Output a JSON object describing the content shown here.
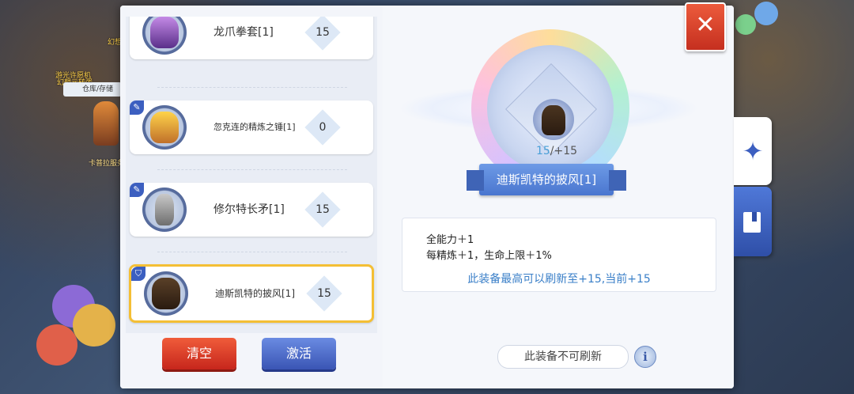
{
  "background": {
    "sign_top": "幻想机",
    "sign_mid": "游光许愿机",
    "sign_mid2": "幻想元转蛋",
    "storage_label": "仓库/存储",
    "npc_label": "卡普拉服务"
  },
  "equip_list": {
    "items": [
      {
        "name": "龙爪拳套[1]",
        "count": "15",
        "selected": false
      },
      {
        "name": "忽克连的精炼之锤[1]",
        "count": "0",
        "selected": false
      },
      {
        "name": "修尔特长矛[1]",
        "count": "15",
        "selected": false
      },
      {
        "name": "迪斯凯特的披风[1]",
        "count": "15",
        "selected": true
      }
    ]
  },
  "buttons": {
    "clear_label": "清空",
    "activate_label": "激活"
  },
  "detail": {
    "level_current": "15",
    "level_sep_max": "/+15",
    "item_name": "迪斯凯特的披风[1]",
    "attr_1": "全能力＋1",
    "attr_2": "每精炼＋1，生命上限＋1%",
    "refresh_note": "此装备最高可以刷新至+15,当前+15",
    "status_label": "此装备不可刷新",
    "info_symbol": "i"
  },
  "window": {
    "close_symbol": "✕",
    "side_tab_symbol": "✦"
  },
  "colors": {
    "accent_blue": "#3c5fc0",
    "select_gold": "#f4bf35",
    "clear_red": "#d9382a",
    "note_blue": "#3a7fc8"
  }
}
